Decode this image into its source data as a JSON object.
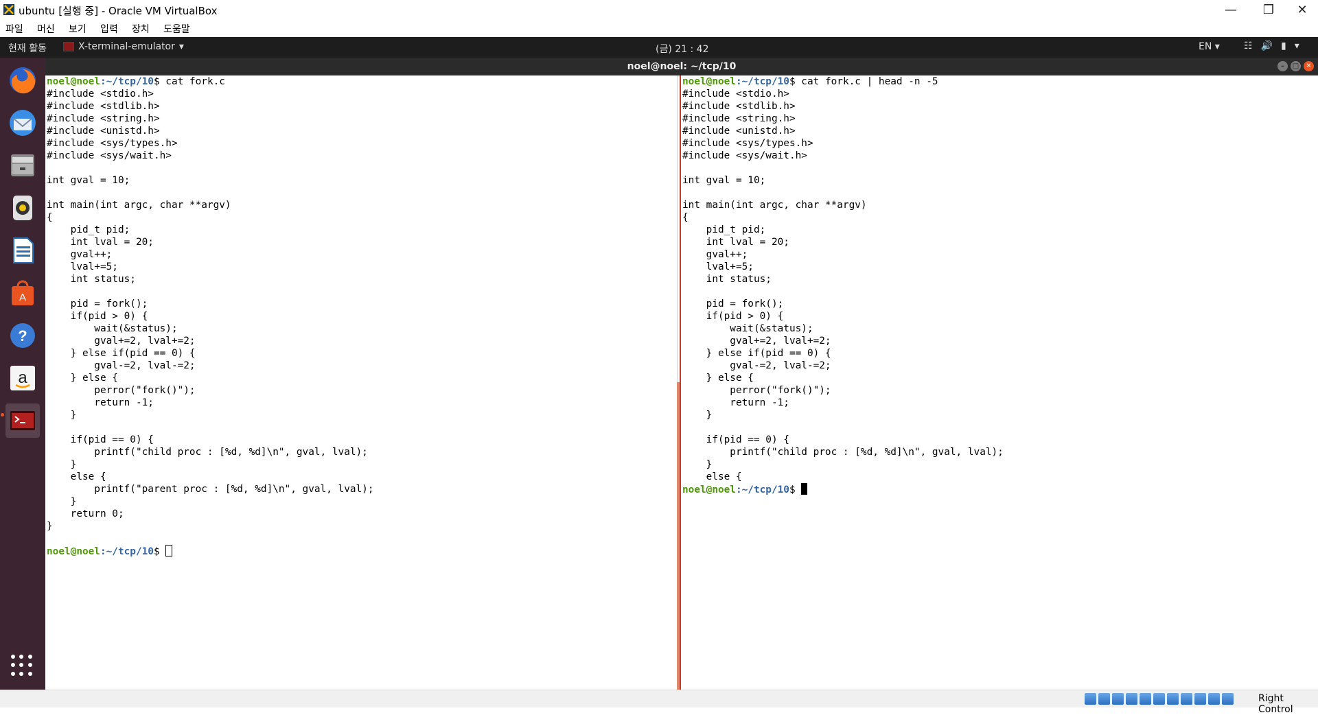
{
  "window": {
    "title": "ubuntu [실행 중] - Oracle VM VirtualBox",
    "menu": [
      "파일",
      "머신",
      "보기",
      "입력",
      "장치",
      "도움말"
    ]
  },
  "topbar": {
    "activities": "현재 활동",
    "app_menu": "X-terminal-emulator",
    "clock": "(금) 21 : 42",
    "lang": "EN"
  },
  "dock": {
    "items": [
      "firefox-icon",
      "thunderbird-icon",
      "files-icon",
      "rhythmbox-icon",
      "libreoffice-writer-icon",
      "software-center-icon",
      "help-icon",
      "amazon-icon",
      "terminal-icon"
    ]
  },
  "terminal": {
    "title": "noel@noel: ~/tcp/10",
    "prompt_user": "noel@noel",
    "prompt_path": ":~/tcp/10",
    "prompt_symbol": "$ ",
    "left": {
      "command": "cat fork.c",
      "output": "#include <stdio.h>\n#include <stdlib.h>\n#include <string.h>\n#include <unistd.h>\n#include <sys/types.h>\n#include <sys/wait.h>\n\nint gval = 10;\n\nint main(int argc, char **argv)\n{\n    pid_t pid;\n    int lval = 20;\n    gval++;\n    lval+=5;\n    int status;\n\n    pid = fork();\n    if(pid > 0) {\n        wait(&status);\n        gval+=2, lval+=2;\n    } else if(pid == 0) {\n        gval-=2, lval-=2;\n    } else {\n        perror(\"fork()\");\n        return -1;\n    }\n\n    if(pid == 0) {\n        printf(\"child proc : [%d, %d]\\n\", gval, lval);\n    }\n    else {\n        printf(\"parent proc : [%d, %d]\\n\", gval, lval);\n    }\n    return 0;\n}\n"
    },
    "right": {
      "command": "cat fork.c | head -n -5",
      "output": "#include <stdio.h>\n#include <stdlib.h>\n#include <string.h>\n#include <unistd.h>\n#include <sys/types.h>\n#include <sys/wait.h>\n\nint gval = 10;\n\nint main(int argc, char **argv)\n{\n    pid_t pid;\n    int lval = 20;\n    gval++;\n    lval+=5;\n    int status;\n\n    pid = fork();\n    if(pid > 0) {\n        wait(&status);\n        gval+=2, lval+=2;\n    } else if(pid == 0) {\n        gval-=2, lval-=2;\n    } else {\n        perror(\"fork()\");\n        return -1;\n    }\n\n    if(pid == 0) {\n        printf(\"child proc : [%d, %d]\\n\", gval, lval);\n    }\n    else {"
    }
  },
  "statusbar": {
    "host_key": "Right Control"
  }
}
